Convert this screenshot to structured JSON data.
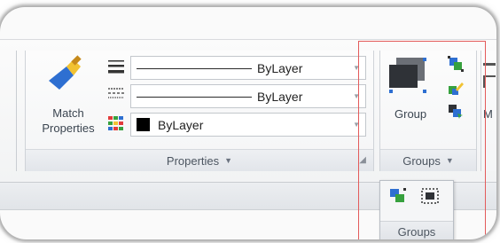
{
  "properties_panel": {
    "match_properties": {
      "line1": "Match",
      "line2": "Properties",
      "icon": "match-properties-brush-icon"
    },
    "lineweight_combo": {
      "value": "ByLayer",
      "icon": "lineweight-icon"
    },
    "linetype_combo": {
      "value": "ByLayer",
      "icon": "linetype-icon"
    },
    "color_combo": {
      "value": "ByLayer",
      "icon": "color-grid-icon",
      "swatch_color": "#000000"
    },
    "title": "Properties",
    "dropdown_icon": "chevron-down-icon",
    "launcher_icon": "dialog-launcher-icon"
  },
  "groups_panel": {
    "group_button_label": "Group",
    "title": "Groups",
    "dropdown_icon": "chevron-down-icon",
    "side_icons": [
      "group-manager-icon",
      "group-edit-icon",
      "group-select-icon"
    ]
  },
  "next_panel": {
    "label_fragment": "M"
  },
  "groups_flyout": {
    "title": "Groups",
    "icons": [
      "group-manager-icon",
      "group-bounding-box-icon"
    ]
  },
  "colors": {
    "highlight": "#e35b5b",
    "accent_blue": "#2e6fd1",
    "accent_yellow": "#f1c232"
  }
}
